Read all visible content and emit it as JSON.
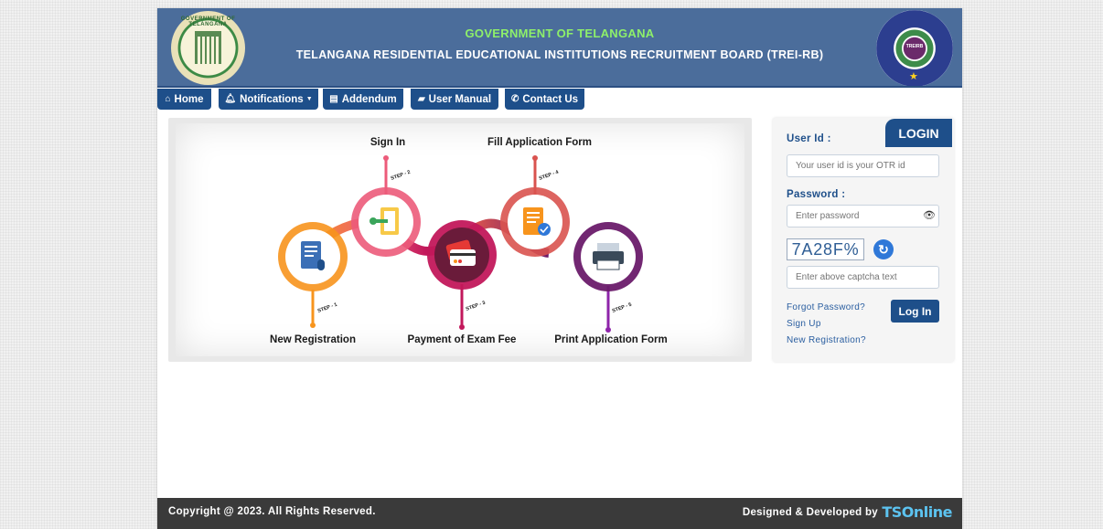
{
  "header": {
    "gov_title": "GOVERNMENT OF TELANGANA",
    "board_title": "TELANGANA RESIDENTIAL EDUCATIONAL INSTITUTIONS RECRUITMENT BOARD (TREI-RB)",
    "left_emblem_text": "GOVERNMENT OF TELANGANA",
    "right_logo_text": "TREIRB",
    "colors": {
      "bar": "#4b6d9b",
      "gov_title": "#8ef06a"
    }
  },
  "nav": {
    "items": [
      {
        "label": "Home",
        "icon": "home-icon"
      },
      {
        "label": "Notifications",
        "icon": "bell-icon",
        "dropdown": true
      },
      {
        "label": "Addendum",
        "icon": "document-icon"
      },
      {
        "label": "User Manual",
        "icon": "book-icon"
      },
      {
        "label": "Contact Us",
        "icon": "phone-icon"
      }
    ],
    "color": "#1e4f8a"
  },
  "steps": {
    "items": [
      {
        "label": "New Registration",
        "tag": "STEP - 1",
        "color": "#f7941d"
      },
      {
        "label": "Sign In",
        "tag": "STEP - 2",
        "color": "#ec5b7a"
      },
      {
        "label": "Payment of Exam Fee",
        "tag": "STEP - 3",
        "color": "#c2185b"
      },
      {
        "label": "Fill Application Form",
        "tag": "STEP - 4",
        "color": "#d9534f"
      },
      {
        "label": "Print Application Form",
        "tag": "STEP - 5",
        "color": "#6a1b6a"
      }
    ]
  },
  "login": {
    "tab_label": "LOGIN",
    "user_id_label": "User Id :",
    "user_id_placeholder": "Your user id is your OTR id",
    "password_label": "Password :",
    "password_placeholder": "Enter password",
    "captcha_value": "7A28F%",
    "captcha_placeholder": "Enter above captcha text",
    "forgot_password": "Forgot Password?",
    "sign_up": "Sign Up",
    "new_registration": "New Registration?",
    "login_button": "Log In"
  },
  "footer": {
    "copyright": "Copyright @ 2023. All Rights Reserved.",
    "designed_by": "Designed & Developed by",
    "brand": "TSOnline"
  }
}
